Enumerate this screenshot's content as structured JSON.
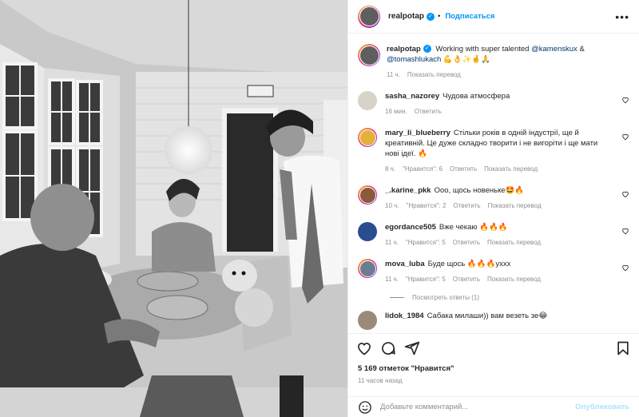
{
  "header": {
    "username": "realpotap",
    "verified_mark": "✓",
    "follow_label": "Подписаться",
    "more_label": "•••"
  },
  "caption": {
    "username": "realpotap",
    "text": "Working with super talented",
    "mention1": "@kamenskux",
    "amp": "&",
    "mention2": "@tomashlukach",
    "emojis": "💪👌✨🤞🙏",
    "time": "11 ч.",
    "translate": "Показать перевод"
  },
  "comments": [
    {
      "username": "sasha_nazorey",
      "text": "Чудова атмосфера",
      "time": "16 мин.",
      "likes": "",
      "reply": "Ответить",
      "translate": "",
      "avatar_color": "#d8d3c8"
    },
    {
      "username": "mary_li_blueberry",
      "text": "Стільки років в одній індустрії, ще й креативній. Це дуже складно творити і не вигоріти і ще мати нові ідеї. 🔥",
      "time": "8 ч.",
      "likes": "\"Нравится\": 6",
      "reply": "Ответить",
      "translate": "Показать перевод",
      "avatar_color": "#e4b23a"
    },
    {
      "username": "_.karine_pkk",
      "text": "Ооо, щось новенькe🤩🔥",
      "time": "10 ч.",
      "likes": "\"Нравится\": 2",
      "reply": "Ответить",
      "translate": "Показать перевод",
      "avatar_color": "#8a5a3c"
    },
    {
      "username": "egordance505",
      "text": "Вже чекаю 🔥🔥🔥",
      "time": "11 ч.",
      "likes": "\"Нравится\": 5",
      "reply": "Ответить",
      "translate": "Показать перевод",
      "avatar_color": "#2a4d8f"
    },
    {
      "username": "mova_luba",
      "text": "Буде щось 🔥🔥🔥ухxx",
      "time": "11 ч.",
      "likes": "\"Нравится\": 5",
      "reply": "Ответить",
      "translate": "Показать перевод",
      "avatar_color": "#6a7d93"
    }
  ],
  "view_replies": "Посмотреть ответы (1)",
  "partial_comment": {
    "username": "lidok_1984",
    "text": "Сабака милаши)) вам везеть зе😂"
  },
  "icons": {
    "like": "heart-icon",
    "comment": "comment-icon",
    "share": "share-icon",
    "save": "bookmark-icon",
    "emoji": "emoji-icon"
  },
  "stats": {
    "likes_text": "5 169 отметок \"Нравится\"",
    "posted": "11 часов назад"
  },
  "add_comment": {
    "placeholder": "Добавьте комментарий...",
    "publish": "Опубликовать"
  },
  "colors": {
    "accent": "#0095f6",
    "muted": "#8e8e8e",
    "publish_disabled": "#b2dffc"
  }
}
